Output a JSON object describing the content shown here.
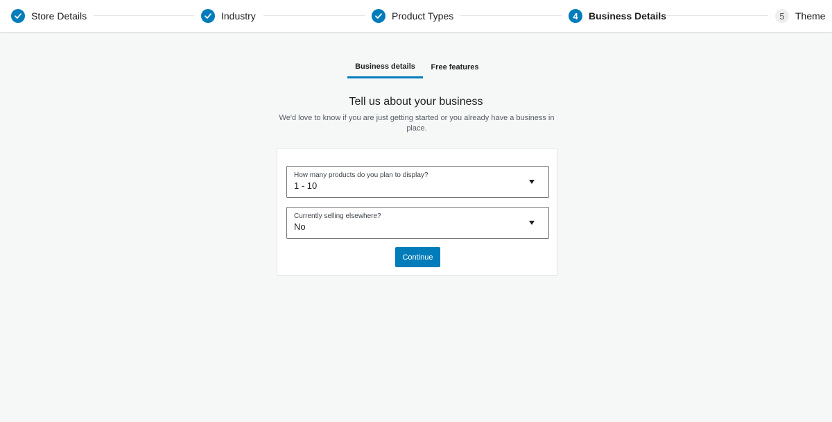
{
  "stepper": {
    "steps": [
      {
        "label": "Store Details",
        "state": "done"
      },
      {
        "label": "Industry",
        "state": "done"
      },
      {
        "label": "Product Types",
        "state": "done"
      },
      {
        "label": "Business Details",
        "state": "current",
        "number": "4"
      },
      {
        "label": "Theme",
        "state": "pending",
        "number": "5"
      }
    ]
  },
  "tabs": [
    {
      "label": "Business details",
      "active": true
    },
    {
      "label": "Free features",
      "active": false
    }
  ],
  "main": {
    "title": "Tell us about your business",
    "subtitle": "We'd love to know if you are just getting started or you already have a business in place."
  },
  "form": {
    "products": {
      "label": "How many products do you plan to display?",
      "value": "1 - 10"
    },
    "selling": {
      "label": "Currently selling elsewhere?",
      "value": "No"
    },
    "continue_label": "Continue"
  },
  "colors": {
    "accent": "#007cba",
    "background": "#f6f7f7",
    "pending_circle": "#eeeeee"
  }
}
